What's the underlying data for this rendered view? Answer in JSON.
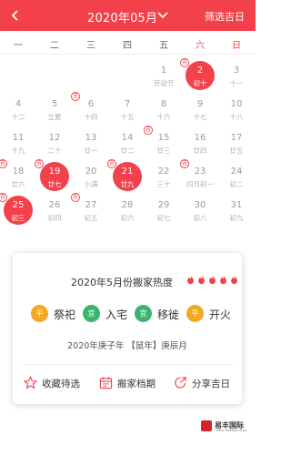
{
  "header": {
    "title": "2020年05月",
    "filter_label": "筛选吉日",
    "accent": "#f2414b"
  },
  "weekdays": [
    "一",
    "二",
    "三",
    "四",
    "五",
    "六",
    "日"
  ],
  "calendar": {
    "days": [
      {
        "day": "1",
        "lunar": "劳动节",
        "col": 4,
        "row": 0
      },
      {
        "day": "2",
        "lunar": "初十",
        "col": 5,
        "row": 0,
        "selected": true,
        "tag": "吉"
      },
      {
        "day": "3",
        "lunar": "十一",
        "col": 6,
        "row": 0
      },
      {
        "day": "4",
        "lunar": "十二",
        "col": 0,
        "row": 1
      },
      {
        "day": "5",
        "lunar": "立夏",
        "col": 1,
        "row": 1
      },
      {
        "day": "6",
        "lunar": "十四",
        "col": 2,
        "row": 1,
        "tag": "吉"
      },
      {
        "day": "7",
        "lunar": "十五",
        "col": 3,
        "row": 1
      },
      {
        "day": "8",
        "lunar": "十六",
        "col": 4,
        "row": 1
      },
      {
        "day": "9",
        "lunar": "十七",
        "col": 5,
        "row": 1
      },
      {
        "day": "10",
        "lunar": "十八",
        "col": 6,
        "row": 1
      },
      {
        "day": "11",
        "lunar": "十九",
        "col": 0,
        "row": 2
      },
      {
        "day": "12",
        "lunar": "二十",
        "col": 1,
        "row": 2
      },
      {
        "day": "13",
        "lunar": "廿一",
        "col": 2,
        "row": 2
      },
      {
        "day": "14",
        "lunar": "廿二",
        "col": 3,
        "row": 2
      },
      {
        "day": "15",
        "lunar": "廿三",
        "col": 4,
        "row": 2,
        "tag": "吉"
      },
      {
        "day": "16",
        "lunar": "廿四",
        "col": 5,
        "row": 2
      },
      {
        "day": "17",
        "lunar": "廿五",
        "col": 6,
        "row": 2
      },
      {
        "day": "18",
        "lunar": "廿六",
        "col": 0,
        "row": 3,
        "tag": "吉"
      },
      {
        "day": "19",
        "lunar": "廿七",
        "col": 1,
        "row": 3,
        "selected": true,
        "tag": "吉"
      },
      {
        "day": "20",
        "lunar": "小满",
        "col": 2,
        "row": 3
      },
      {
        "day": "21",
        "lunar": "廿九",
        "col": 3,
        "row": 3,
        "selected": true,
        "tag": "吉"
      },
      {
        "day": "22",
        "lunar": "三十",
        "col": 4,
        "row": 3
      },
      {
        "day": "23",
        "lunar": "四月初一",
        "col": 5,
        "row": 3,
        "tag": "吉"
      },
      {
        "day": "24",
        "lunar": "初二",
        "col": 6,
        "row": 3
      },
      {
        "day": "25",
        "lunar": "初三",
        "col": 0,
        "row": 4,
        "selected": true,
        "tag": "吉"
      },
      {
        "day": "26",
        "lunar": "初四",
        "col": 1,
        "row": 4
      },
      {
        "day": "27",
        "lunar": "初五",
        "col": 2,
        "row": 4,
        "tag": "吉"
      },
      {
        "day": "28",
        "lunar": "初六",
        "col": 3,
        "row": 4
      },
      {
        "day": "29",
        "lunar": "初七",
        "col": 4,
        "row": 4
      },
      {
        "day": "30",
        "lunar": "初八",
        "col": 5,
        "row": 4
      },
      {
        "day": "31",
        "lunar": "初九",
        "col": 6,
        "row": 4
      }
    ]
  },
  "card": {
    "heat_title": "2020年5月份搬家热度",
    "flames": 5,
    "activities": [
      {
        "badge": "平",
        "label": "祭祀",
        "color": "#f5a623"
      },
      {
        "badge": "宜",
        "label": "入宅",
        "color": "#3ab56c"
      },
      {
        "badge": "宜",
        "label": "移徙",
        "color": "#3ab56c"
      },
      {
        "badge": "平",
        "label": "开火",
        "color": "#f5a623"
      }
    ],
    "ganzhi": "2020年庚子年 【鼠年】庚辰月",
    "actions": [
      {
        "label": "收藏待选",
        "icon": "star-icon"
      },
      {
        "label": "搬家档期",
        "icon": "calendar-icon"
      },
      {
        "label": "分享吉日",
        "icon": "share-icon"
      }
    ]
  },
  "logo": {
    "brand": "易丰国际",
    "sub": "YIFENG INTERNATIONAL"
  }
}
